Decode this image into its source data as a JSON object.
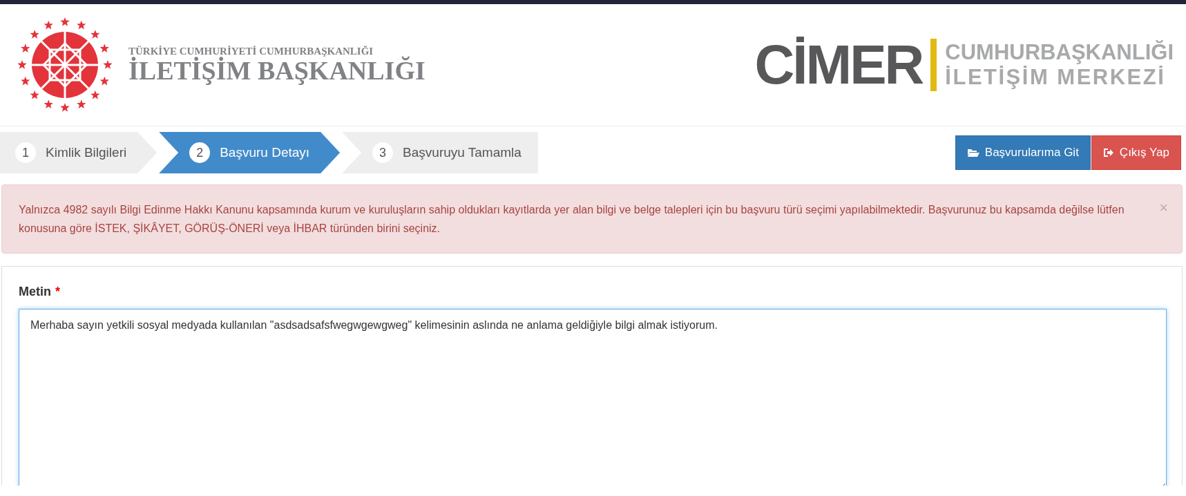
{
  "header": {
    "org_subtitle": "TÜRKİYE CUMHURİYETİ CUMHURBAŞKANLIĞI",
    "org_title": "İLETİŞİM BAŞKANLIĞI",
    "brand": "CİMER",
    "brand_line1": "CUMHURBAŞKANLIĞI",
    "brand_line2": "İLETİŞİM MERKEZİ"
  },
  "steps": [
    {
      "number": "1",
      "label": "Kimlik Bilgileri",
      "selected": false
    },
    {
      "number": "2",
      "label": "Başvuru Detayı",
      "selected": true
    },
    {
      "number": "3",
      "label": "Başvuruyu Tamamla",
      "selected": false
    }
  ],
  "actions": [
    {
      "label": "Başvurularıma Git",
      "kind": "primary"
    },
    {
      "label": "Çıkış Yap",
      "kind": "danger"
    }
  ],
  "alert": {
    "text": "Yalnızca 4982 sayılı Bilgi Edinme Hakkı Kanunu kapsamında kurum ve kuruluşların sahip oldukları kayıtlarda yer alan bilgi ve belge talepleri için bu başvuru türü seçimi yapılabilmektedir. Başvurunuz bu kapsamda değilse lütfen konusuna göre İSTEK, ŞİKÂYET, GÖRÜŞ-ÖNERİ veya İHBAR türünden birini seçiniz.",
    "close": "×"
  },
  "form": {
    "label": "Metin",
    "required_mark": "*",
    "value": "Merhaba sayın yetkili sosyal medyada kullanılan \"asdsadsafsfwegwgewgweg\" kelimesinin aslında ne anlama geldiğiyle bilgi almak istiyorum."
  }
}
